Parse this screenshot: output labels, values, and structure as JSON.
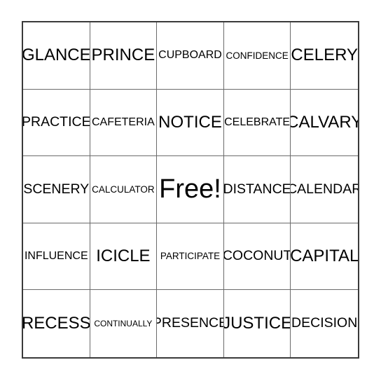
{
  "card": {
    "type": "bingo-card",
    "columns": 5,
    "rows": 5,
    "free_space_index": 12,
    "background_color": "#ffffff",
    "text_color": "#000000",
    "outer_border_color": "#3a3a3a",
    "grid_line_color": "#6b6b6b",
    "cells": [
      {
        "text": "GLANCE",
        "size": "s-lg",
        "free": false
      },
      {
        "text": "PRINCE",
        "size": "s-lg",
        "free": false
      },
      {
        "text": "CUPBOARD",
        "size": "s-sm",
        "free": false
      },
      {
        "text": "CONFIDENCE",
        "size": "s-xs",
        "free": false
      },
      {
        "text": "CELERY",
        "size": "s-lg",
        "free": false
      },
      {
        "text": "PRACTICE",
        "size": "s-md",
        "free": false
      },
      {
        "text": "CAFETERIA",
        "size": "s-sm",
        "free": false
      },
      {
        "text": "NOTICE",
        "size": "s-lg",
        "free": false
      },
      {
        "text": "CELEBRATE",
        "size": "s-sm",
        "free": false
      },
      {
        "text": "CALVARY",
        "size": "s-lg",
        "free": false
      },
      {
        "text": "SCENERY",
        "size": "s-md",
        "free": false
      },
      {
        "text": "CALCULATOR",
        "size": "s-xs",
        "free": false
      },
      {
        "text": "Free!",
        "size": "s-xl",
        "free": true
      },
      {
        "text": "DISTANCE",
        "size": "s-md",
        "free": false
      },
      {
        "text": "CALENDAR",
        "size": "s-md",
        "free": false
      },
      {
        "text": "INFLUENCE",
        "size": "s-sm",
        "free": false
      },
      {
        "text": "ICICLE",
        "size": "s-lg",
        "free": false
      },
      {
        "text": "PARTICIPATE",
        "size": "s-xs",
        "free": false
      },
      {
        "text": "COCONUT",
        "size": "s-md",
        "free": false
      },
      {
        "text": "CAPITAL",
        "size": "s-lg",
        "free": false
      },
      {
        "text": "RECESS",
        "size": "s-lg",
        "free": false
      },
      {
        "text": "CONTINUALLY",
        "size": "s-xxs",
        "free": false
      },
      {
        "text": "PRESENCE",
        "size": "s-md",
        "free": false
      },
      {
        "text": "JUSTICE",
        "size": "s-lg",
        "free": false
      },
      {
        "text": "DECISION",
        "size": "s-md",
        "free": false
      }
    ]
  }
}
